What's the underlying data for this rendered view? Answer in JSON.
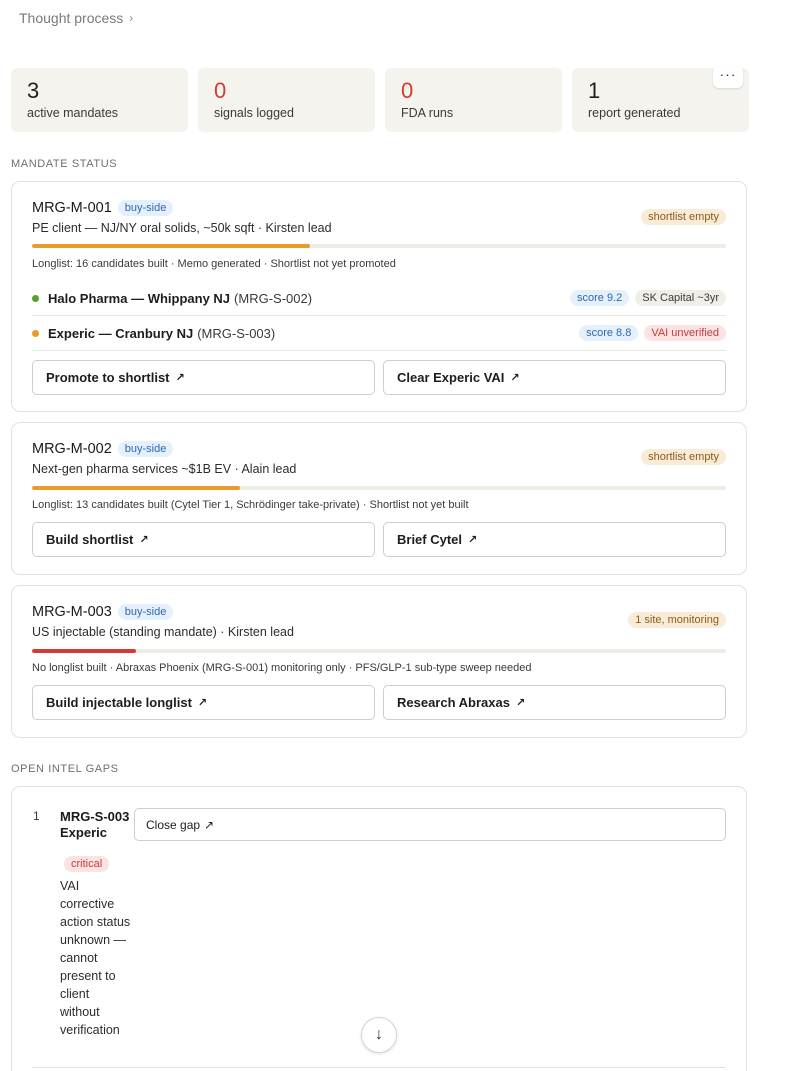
{
  "header": {
    "thought_label": "Thought process",
    "chevron": "›"
  },
  "stats": [
    {
      "value": "3",
      "label": "active mandates",
      "color": "#1f1f1f"
    },
    {
      "value": "0",
      "label": "signals logged",
      "color": "#d63b2f"
    },
    {
      "value": "0",
      "label": "FDA runs",
      "color": "#d63b2f"
    },
    {
      "value": "1",
      "label": "report generated",
      "color": "#1f1f1f"
    }
  ],
  "more_menu": {
    "label": "···",
    "icon": "more-horizontal-icon"
  },
  "mandate_section_label": "MANDATE STATUS",
  "mandates": [
    {
      "id": "MRG-M-001",
      "side": "buy-side",
      "subtitle": "PE client — NJ/NY oral solids, ~50k sqft · Kirsten lead",
      "status": "shortlist empty",
      "progress": 0.4,
      "progress_color": "#e89a2b",
      "meta": "Longlist: 16 candidates built · Memo generated · Shortlist not yet promoted",
      "candidates": [
        {
          "name": "Halo Pharma — Whippany NJ",
          "ref": "(MRG-S-002)",
          "dot_color": "#5a9e2f",
          "tags": [
            {
              "text": "score 9.2",
              "kind": "blue"
            },
            {
              "text": "SK Capital ~3yr",
              "kind": "gray"
            }
          ]
        },
        {
          "name": "Experic — Cranbury NJ",
          "ref": "(MRG-S-003)",
          "dot_color": "#e89a2b",
          "tags": [
            {
              "text": "score 8.8",
              "kind": "blue"
            },
            {
              "text": "VAI unverified",
              "kind": "red"
            }
          ]
        }
      ],
      "buttons": [
        "Promote to shortlist",
        "Clear Experic VAI"
      ]
    },
    {
      "id": "MRG-M-002",
      "side": "buy-side",
      "subtitle": "Next-gen pharma services ~$1B EV · Alain lead",
      "status": "shortlist empty",
      "progress": 0.3,
      "progress_color": "#e89a2b",
      "meta": "Longlist: 13 candidates built (Cytel Tier 1, Schrödinger take-private) · Shortlist not yet built",
      "buttons": [
        "Build shortlist",
        "Brief Cytel"
      ]
    },
    {
      "id": "MRG-M-003",
      "side": "buy-side",
      "subtitle": "US injectable (standing mandate) · Kirsten lead",
      "status": "1 site, monitoring",
      "progress": 0.15,
      "progress_color": "#d6393a",
      "meta": "No longlist built · Abraxas Phoenix (MRG-S-001) monitoring only · PFS/GLP-1 sub-type sweep needed",
      "buttons": [
        "Build injectable longlist",
        "Research Abraxas"
      ]
    }
  ],
  "gaps_section_label": "OPEN INTEL GAPS",
  "gaps": [
    {
      "num": "1",
      "title": "MRG-S-003 Experic",
      "severity": "critical",
      "description": "VAI corrective action status unknown — cannot present to client without verification",
      "button": "Close gap"
    }
  ],
  "arrow_glyph": "↗",
  "scroll_glyph": "↓"
}
